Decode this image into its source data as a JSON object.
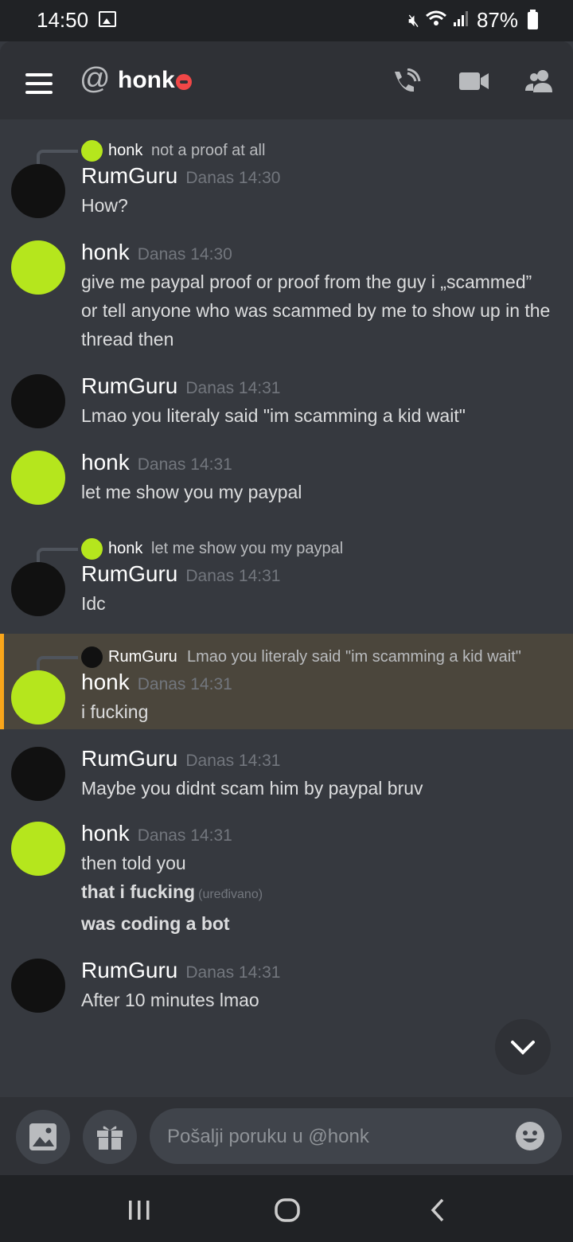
{
  "status_bar": {
    "time": "14:50",
    "battery": "87%"
  },
  "header": {
    "at": "@",
    "title": "honk"
  },
  "messages": [
    {
      "type": "reply",
      "reply_name": "honk",
      "reply_text": "not a proof at all"
    },
    {
      "type": "msg",
      "author": "RumGuru",
      "ts": "Danas 14:30",
      "lines": [
        "How?"
      ]
    },
    {
      "type": "msg",
      "author": "honk",
      "ts": "Danas 14:30",
      "lines": [
        "give me paypal proof or proof from the guy i „scammed”",
        "or tell anyone who was scammed by me to show up in the thread then"
      ]
    },
    {
      "type": "msg",
      "author": "RumGuru",
      "ts": "Danas 14:31",
      "lines": [
        "Lmao you literaly said \"im scamming a kid wait\""
      ]
    },
    {
      "type": "msg",
      "author": "honk",
      "ts": "Danas 14:31",
      "lines": [
        "let me show you my paypal"
      ]
    },
    {
      "type": "reply",
      "reply_name": "honk",
      "reply_text": "let me show you my paypal"
    },
    {
      "type": "msg",
      "author": "RumGuru",
      "ts": "Danas 14:31",
      "lines": [
        "Idc"
      ]
    },
    {
      "type": "reply",
      "reply_name": "RumGuru",
      "reply_text": "Lmao you literaly said \"im scamming a kid wait\""
    },
    {
      "type": "msg",
      "author": "honk",
      "ts": "Danas 14:31",
      "lines": [
        "i fucking"
      ]
    },
    {
      "type": "msg",
      "author": "RumGuru",
      "ts": "Danas 14:31",
      "lines": [
        "Maybe you didnt scam him by paypal bruv"
      ]
    },
    {
      "type": "msg",
      "author": "honk",
      "ts": "Danas 14:31",
      "lines": [
        "then told you",
        "that i fucking",
        "was coding a bot"
      ],
      "edited": "(uređivano)"
    },
    {
      "type": "msg",
      "author": "RumGuru",
      "ts": "Danas 14:31",
      "lines": [
        "After 10 minutes  lmao"
      ]
    }
  ],
  "composer": {
    "placeholder": "Pošalji poruku u @honk"
  }
}
